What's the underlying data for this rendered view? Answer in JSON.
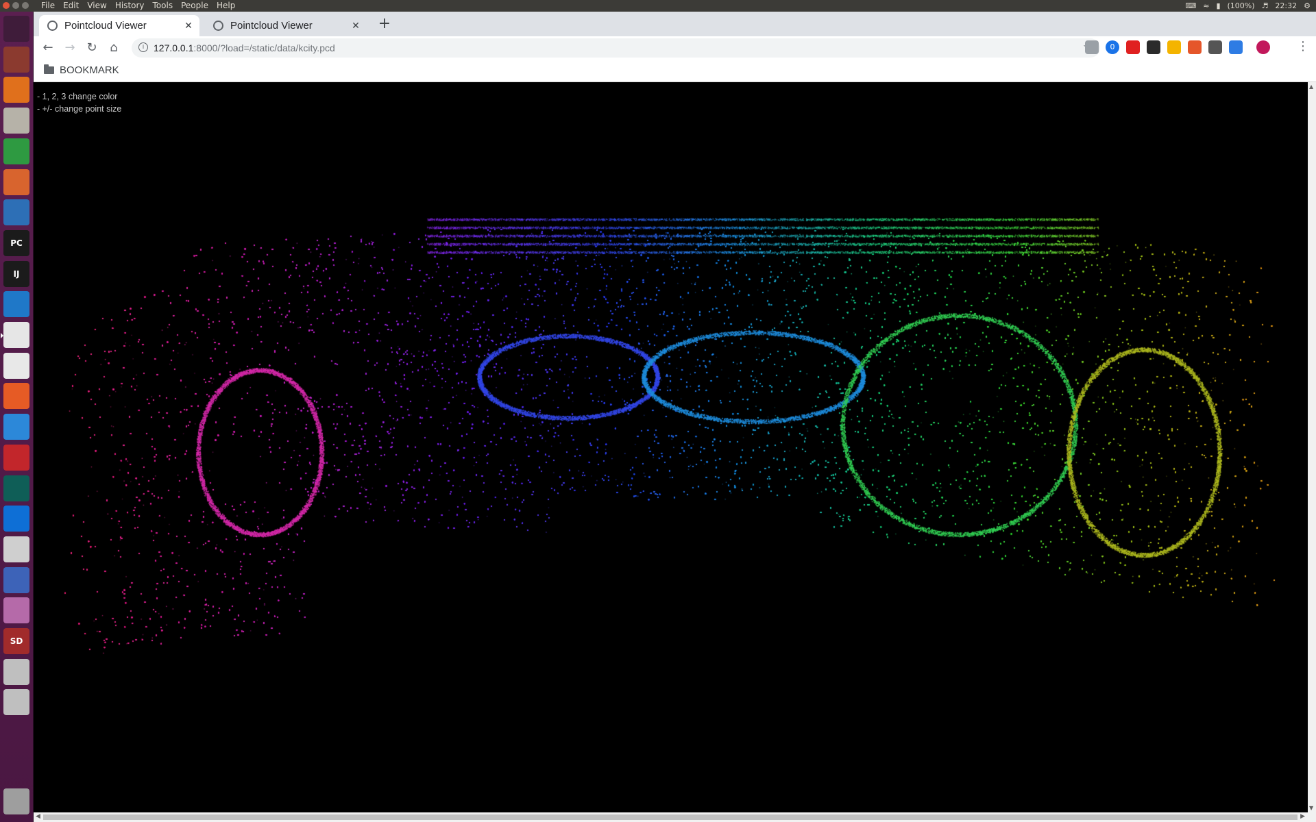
{
  "top_panel": {
    "menu": [
      "File",
      "Edit",
      "View",
      "History",
      "Tools",
      "People",
      "Help"
    ],
    "battery": "(100%)",
    "clock": "22:32"
  },
  "browser": {
    "tabs": [
      {
        "label": "Pointcloud Viewer",
        "active": true
      },
      {
        "label": "Pointcloud Viewer",
        "active": false
      }
    ],
    "new_tab": "+",
    "url_host": "127.0.0.1",
    "url_rest": ":8000/?load=/static/data/kcity.pcd",
    "bookmark_folder": "BOOKMARK",
    "extension_badge": "0"
  },
  "viewer": {
    "help_lines": [
      "- 1, 2, 3 change color",
      "- +/- change point size"
    ]
  },
  "launcher": {
    "apps": [
      {
        "icon": "ubuntu-dash-icon",
        "color": "#3f1c3a"
      },
      {
        "icon": "settings-tool-icon",
        "color": "#8b3a2f"
      },
      {
        "icon": "software-center-icon",
        "color": "#e0701c"
      },
      {
        "icon": "file-manager-icon",
        "color": "#b6b2a8"
      },
      {
        "icon": "spreadsheet-icon",
        "color": "#2e9a41"
      },
      {
        "icon": "presentation-icon",
        "color": "#d8642e"
      },
      {
        "icon": "text-document-icon",
        "color": "#2d6fb6"
      },
      {
        "icon": "pycharm-icon",
        "color": "#1b1b1b",
        "text": "PC"
      },
      {
        "icon": "intellij-icon",
        "color": "#1b1b1b",
        "text": "IJ"
      },
      {
        "icon": "vscode-icon",
        "color": "#1f78c8"
      },
      {
        "icon": "chrome-icon",
        "color": "#e6e6e6"
      },
      {
        "icon": "slack-icon",
        "color": "#e8e8e8"
      },
      {
        "icon": "drawing-pen-icon",
        "color": "#e65b25"
      },
      {
        "icon": "system-monitor-icon",
        "color": "#2c88d9"
      },
      {
        "icon": "media-player-icon",
        "color": "#c2262b"
      },
      {
        "icon": "network-globe-icon",
        "color": "#0f5e57"
      },
      {
        "icon": "teamviewer-icon",
        "color": "#0e6fd6"
      },
      {
        "icon": "camera-icon",
        "color": "#cfcfcf"
      },
      {
        "icon": "network-tool-icon",
        "color": "#3d63b8"
      },
      {
        "icon": "workspace-switcher-icon",
        "color": "#b56aa9"
      },
      {
        "icon": "sd-card-icon",
        "color": "#a12b2b",
        "text": "SD"
      },
      {
        "icon": "drive-icon",
        "color": "#bfbfbf"
      },
      {
        "icon": "drive-icon-2",
        "color": "#bfbfbf"
      }
    ],
    "trash": {
      "icon": "trash-icon",
      "color": "#9e9e9e"
    }
  },
  "extensions": [
    {
      "icon": "cast-icon",
      "color": "#9aa0a6"
    },
    {
      "icon": "extension-badge-icon",
      "color": "#1a73e8"
    },
    {
      "icon": "adblock-icon",
      "color": "#e02020"
    },
    {
      "icon": "grammar-icon",
      "color": "#2b2b2b"
    },
    {
      "icon": "color-picker-icon",
      "color": "#f4b400"
    },
    {
      "icon": "office-icon",
      "color": "#e5562a"
    },
    {
      "icon": "notes-icon",
      "color": "#555555"
    },
    {
      "icon": "translate-icon",
      "color": "#2e7ce4"
    },
    {
      "icon": "profile-avatar-icon",
      "color": "#c2185b"
    }
  ]
}
